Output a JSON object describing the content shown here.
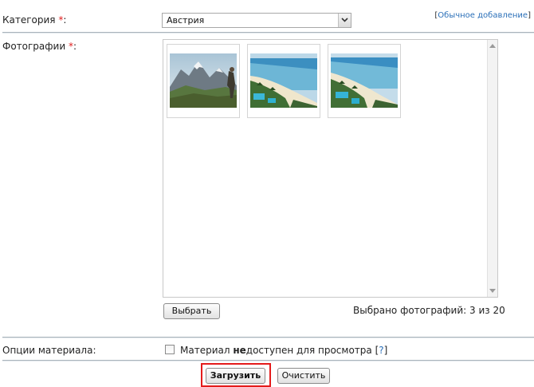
{
  "form": {
    "category": {
      "label": "Категория",
      "required_mark": "*",
      "label_suffix": ":",
      "selected_value": "Австрия"
    },
    "plain_upload_link": {
      "bracket_open": "[",
      "text": "Обычное добавление",
      "bracket_close": "]"
    },
    "photos": {
      "label": "Фотографии",
      "required_mark": "*",
      "label_suffix": ":",
      "thumbnails": [
        {
          "icon": "mountain-hiker-photo"
        },
        {
          "icon": "beach-resort-photo"
        },
        {
          "icon": "beach-resort-photo"
        }
      ],
      "choose_button": "Выбрать",
      "selected_count_text": "Выбрано фотографий: 3 из 20"
    },
    "options": {
      "label": "Опции материала:",
      "checkbox_checked": false,
      "checkbox_text_before": "Материал ",
      "checkbox_text_bold": "не",
      "checkbox_text_after": "доступен для просмотра ",
      "help_open": "[",
      "help_text": "?",
      "help_close": "]"
    },
    "actions": {
      "upload_button": "Загрузить",
      "clear_button": "Очистить"
    }
  },
  "colors": {
    "required": "#e02020",
    "link": "#2a6fb8",
    "highlight": "#e41b1b"
  }
}
